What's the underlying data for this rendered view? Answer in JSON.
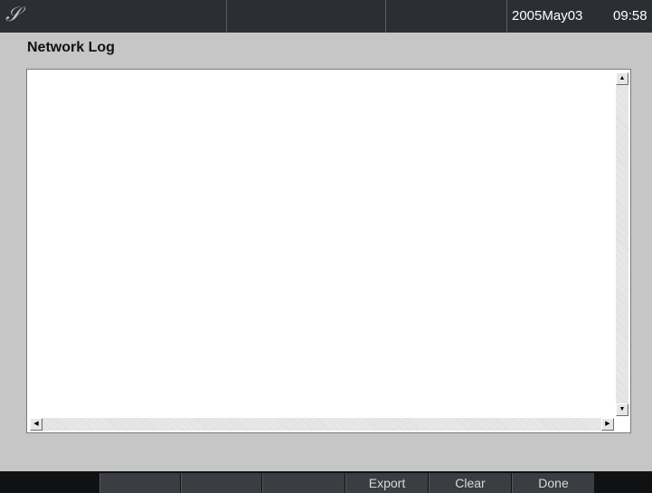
{
  "header": {
    "logo_glyph": "𝒮",
    "date": "2005May03",
    "time": "09:58"
  },
  "page": {
    "title": "Network Log"
  },
  "log": {
    "content": ""
  },
  "scrollbar": {
    "up_arrow": "▲",
    "down_arrow": "▼",
    "left_arrow": "◀",
    "right_arrow": "▶"
  },
  "softkeys": {
    "key1": "",
    "key2": "",
    "key3": "",
    "export": "Export",
    "clear": "Clear",
    "done": "Done"
  },
  "colors": {
    "background": "#c6c6c6",
    "topbar": "#2b2e33",
    "bottombar": "#101113",
    "softkey": "#3a3d42"
  }
}
